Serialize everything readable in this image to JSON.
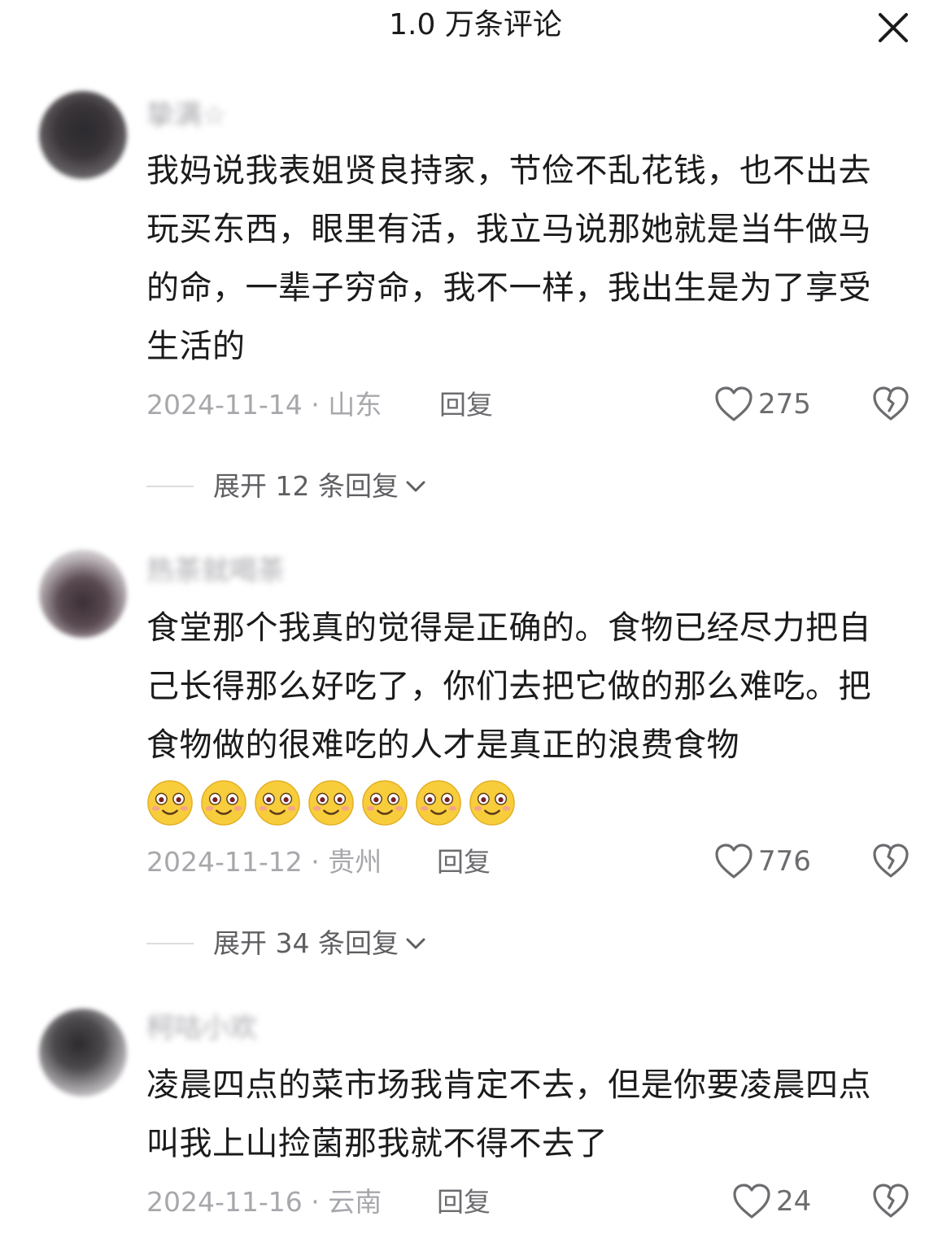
{
  "header": {
    "title": "1.0 万条评论",
    "close_icon": "close-icon"
  },
  "comments": [
    {
      "username": "挚满☆",
      "text": "我妈说我表姐贤良持家，节俭不乱花钱，也不出去玩买东西，眼里有活，我立马说那她就是当牛做马的命，一辈子穷命，我不一样，我出生是为了享受生活的",
      "date_location": "2024-11-14 · 山东",
      "reply_label": "回复",
      "likes": "275",
      "expand_label": "展开 12 条回复",
      "emoji_count": 0
    },
    {
      "username": "热茶就喝茶",
      "text": "食堂那个我真的觉得是正确的。食物已经尽力把自己长得那么好吃了，你们去把它做的那么难吃。把食物做的很难吃的人才是真正的浪费食物",
      "date_location": "2024-11-12 · 贵州",
      "reply_label": "回复",
      "likes": "776",
      "expand_label": "展开 34 条回复",
      "emoji_count": 7
    },
    {
      "username": "柯咕小欢",
      "text": "凌晨四点的菜市场我肯定不去，但是你要凌晨四点叫我上山捡菌那我就不得不去了",
      "date_location": "2024-11-16 · 云南",
      "reply_label": "回复",
      "likes": "24",
      "emoji_count": 0
    }
  ],
  "colors": {
    "text": "#1b1b1d",
    "meta": "#a7a7ac",
    "secondary": "#6c6c70",
    "emoji": "#f8cd3c"
  }
}
